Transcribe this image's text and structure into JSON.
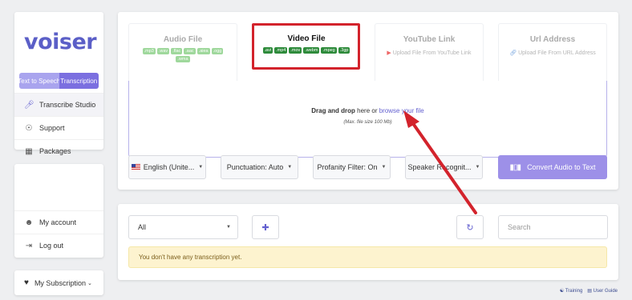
{
  "sidebar": {
    "logo": "voiser",
    "toggle": [
      "Text to Speech",
      "Transcription"
    ],
    "items": [
      {
        "label": "Transcribe Studio",
        "icon": "microphone-icon"
      },
      {
        "label": "Support",
        "icon": "lifebuoy-icon"
      },
      {
        "label": "Packages",
        "icon": "package-icon"
      }
    ],
    "account_items": [
      {
        "label": "My account",
        "icon": "user-icon"
      },
      {
        "label": "Log out",
        "icon": "logout-icon"
      }
    ],
    "subscription": {
      "label": "My Subscription",
      "icon": "heart-icon"
    }
  },
  "tabs": [
    {
      "title": "Audio File",
      "formats": [
        ".mp3",
        ".wav",
        ".flac",
        ".aac",
        ".aiea",
        ".ogg",
        ".wma"
      ]
    },
    {
      "title": "Video File",
      "formats": [
        ".avi",
        ".mp4",
        ".mov",
        ".webm",
        ".mpeg",
        ".3gp"
      ]
    },
    {
      "title": "YouTube Link",
      "sub": "Upload File From YouTube Link"
    },
    {
      "title": "Url Address",
      "sub": "Upload File From URL Address"
    }
  ],
  "dropzone": {
    "main_bold": "Drag and drop",
    "main_mid": " here or ",
    "main_link": "browse your file",
    "note": "(Max. file size 100 Mb)"
  },
  "controls": {
    "language": "English (Unite...",
    "punctuation": "Punctuation: Auto",
    "profanity": "Profanity Filter: On",
    "speaker": "Speaker Recognit...",
    "convert": "Convert Audio to Text"
  },
  "list": {
    "filter": "All",
    "search_placeholder": "Search",
    "empty_notice": "You don't have any transcription yet."
  },
  "footer": {
    "training": "Training",
    "guide": "User Guide"
  },
  "colors": {
    "brand": "#5b5fc7",
    "accent": "#9d90e8",
    "highlight": "#d3232c",
    "format_badge": "#2e8b3b"
  }
}
